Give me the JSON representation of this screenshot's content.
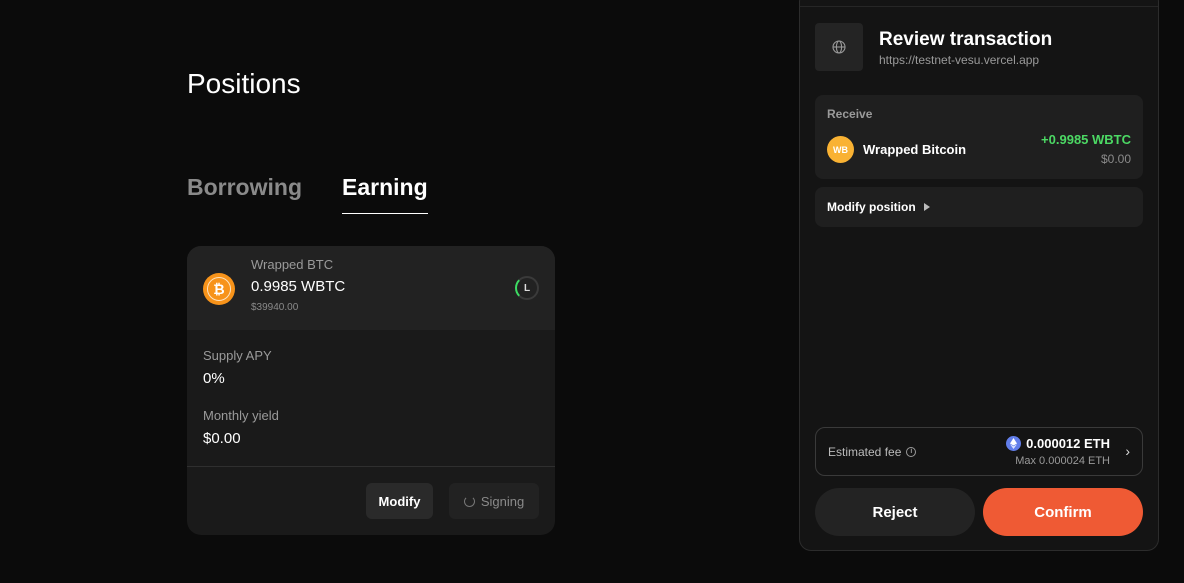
{
  "positions": {
    "title": "Positions",
    "tabs": [
      {
        "label": "Borrowing",
        "active": false
      },
      {
        "label": "Earning",
        "active": true
      }
    ],
    "card": {
      "asset_name": "Wrapped BTC",
      "amount": "0.9985 WBTC",
      "usd_value": "$39940.00",
      "ltv_label": "L",
      "asset_glyph": "₿",
      "supply_apy_label": "Supply APY",
      "supply_apy_value": "0%",
      "monthly_yield_label": "Monthly yield",
      "monthly_yield_value": "$0.00",
      "modify_label": "Modify",
      "signing_label": "Signing"
    }
  },
  "wallet": {
    "title": "Review transaction",
    "url": "https://testnet-vesu.vercel.app",
    "receive": {
      "label": "Receive",
      "token_icon_text": "WB",
      "token_name": "Wrapped Bitcoin",
      "amount": "+0.9985 WBTC",
      "usd": "$0.00"
    },
    "modify_position_label": "Modify position",
    "fee": {
      "label": "Estimated fee",
      "info_glyph": "i",
      "amount": "0.000012 ETH",
      "max": "Max 0.000024 ETH",
      "chevron": "›"
    },
    "reject_label": "Reject",
    "confirm_label": "Confirm"
  },
  "colors": {
    "background": "#0b0b0b",
    "accent_confirm": "#ef5a34",
    "positive_green": "#4cd964",
    "btc_orange": "#f7931a",
    "eth_blue": "#627eea"
  },
  "icons": [
    "bitcoin-icon",
    "ltv-ring-icon",
    "spinner-icon",
    "globe-icon",
    "wbtc-icon",
    "caret-right-icon",
    "info-icon",
    "eth-icon",
    "chevron-right-icon"
  ]
}
